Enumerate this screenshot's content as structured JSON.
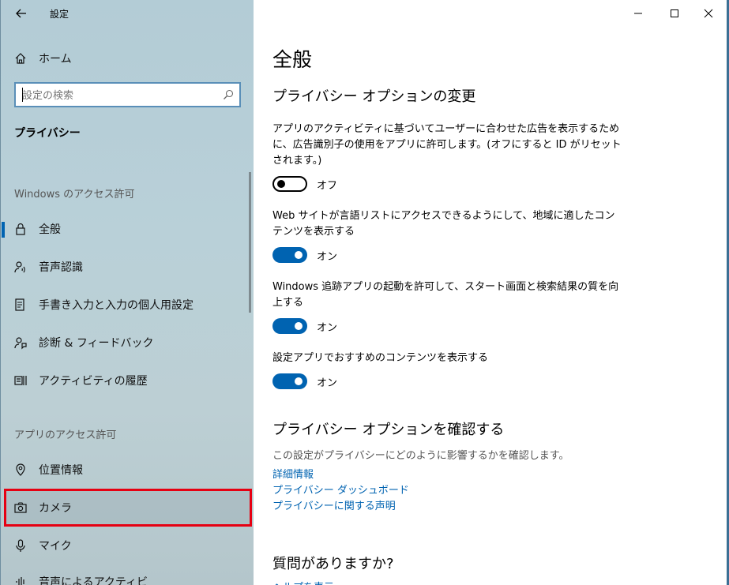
{
  "window": {
    "title": "設定"
  },
  "sidebar": {
    "home_label": "ホーム",
    "search_placeholder": "設定の検索",
    "section_title": "プライバシー",
    "group_windows": "Windows のアクセス許可",
    "group_apps": "アプリのアクセス許可",
    "items": [
      {
        "label": "全般",
        "icon": "lock-icon",
        "selected": true
      },
      {
        "label": "音声認識",
        "icon": "speech-icon"
      },
      {
        "label": "手書き入力と入力の個人用設定",
        "icon": "inking-icon"
      },
      {
        "label": "診断 & フィードバック",
        "icon": "feedback-icon"
      },
      {
        "label": "アクティビティの履歴",
        "icon": "history-icon"
      },
      {
        "label": "位置情報",
        "icon": "location-icon"
      },
      {
        "label": "カメラ",
        "icon": "camera-icon",
        "highlighted": true
      },
      {
        "label": "マイク",
        "icon": "microphone-icon"
      },
      {
        "label": "音声によるアクティビ",
        "icon": "voice-activation-icon"
      }
    ]
  },
  "main": {
    "title": "全般",
    "options_heading": "プライバシー オプションの変更",
    "settings": [
      {
        "desc": "アプリのアクティビティに基づいてユーザーに合わせた広告を表示するために、広告識別子の使用をアプリに許可します。(オフにすると ID がリセットされます。)",
        "state_label": "オフ",
        "on": false
      },
      {
        "desc": "Web サイトが言語リストにアクセスできるようにして、地域に適したコンテンツを表示する",
        "state_label": "オン",
        "on": true
      },
      {
        "desc": "Windows 追跡アプリの起動を許可して、スタート画面と検索結果の質を向上する",
        "state_label": "オン",
        "on": true
      },
      {
        "desc": "設定アプリでおすすめのコンテンツを表示する",
        "state_label": "オン",
        "on": true
      }
    ],
    "confirm_heading": "プライバシー オプションを確認する",
    "confirm_note": "この設定がプライバシーにどのように影響するかを確認します。",
    "links": [
      "詳細情報",
      "プライバシー ダッシュボード",
      "プライバシーに関する声明"
    ],
    "question_heading": "質問がありますか?",
    "help_link": "ヘルプを表示"
  },
  "colors": {
    "accent": "#0063b1",
    "highlight": "#e60012",
    "sidebar_bg": "#b9d0d8"
  }
}
